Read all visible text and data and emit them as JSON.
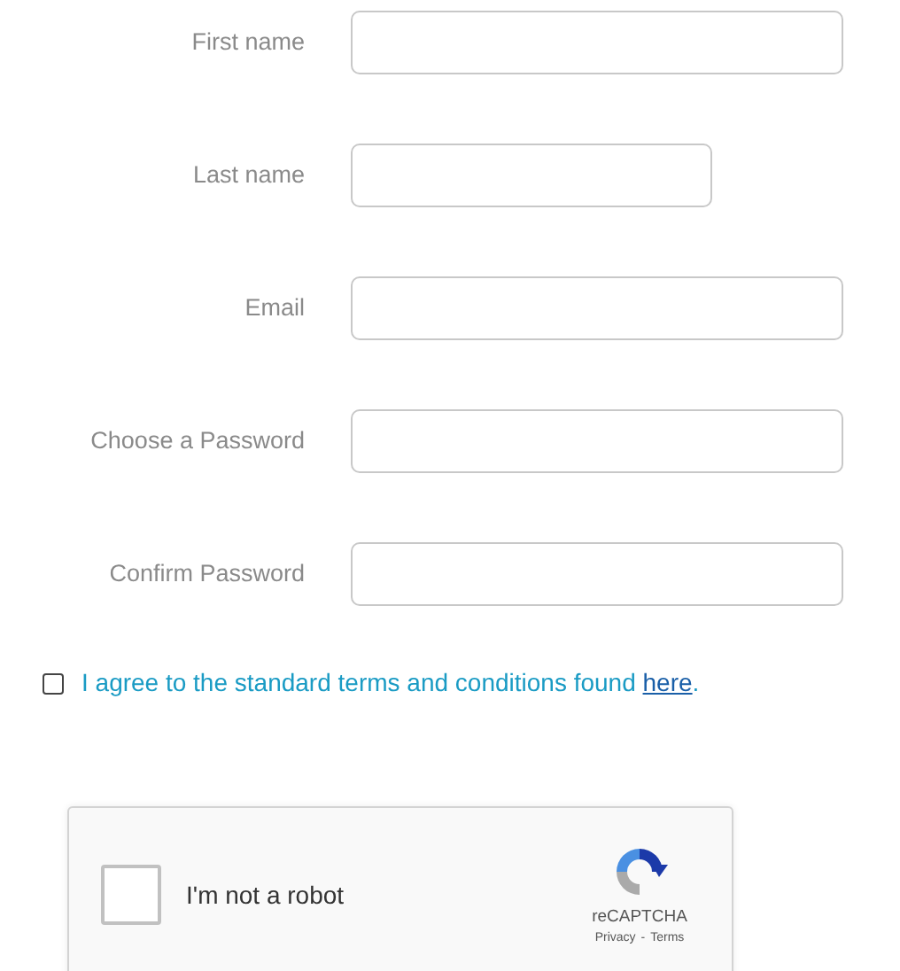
{
  "fields": [
    {
      "label": "First name"
    },
    {
      "label": "Last name"
    },
    {
      "label": "Email"
    },
    {
      "label": "Choose a Password"
    },
    {
      "label": "Confirm Password"
    }
  ],
  "terms": {
    "checked": false,
    "text": "I agree to the standard terms and conditions found ",
    "link": "here",
    "after": "."
  },
  "captcha": {
    "checked": false,
    "label": "I'm not a robot",
    "brand": "reCAPTCHA",
    "privacy": "Privacy",
    "separator": "-",
    "terms": "Terms"
  }
}
